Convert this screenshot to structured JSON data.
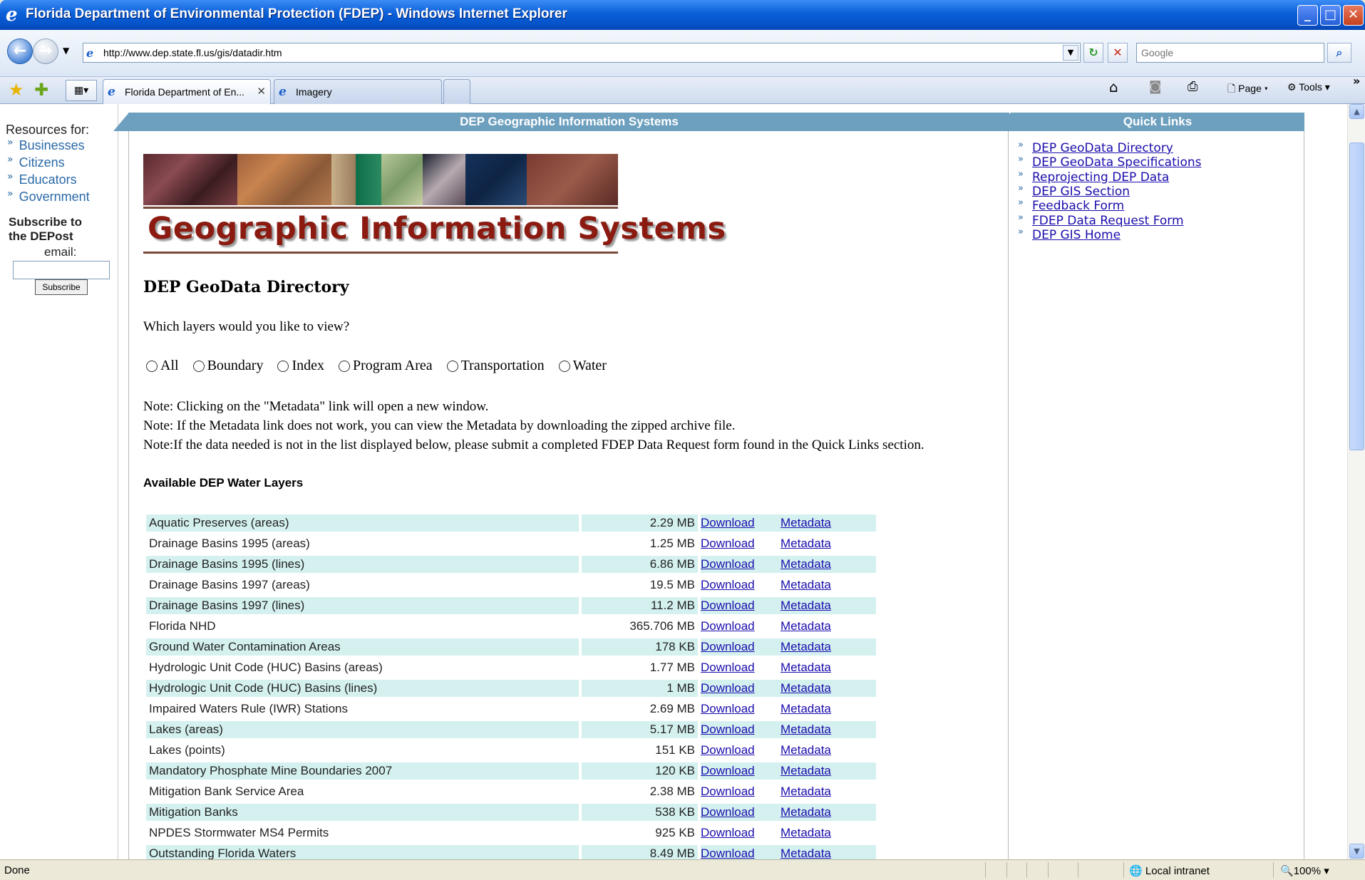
{
  "window": {
    "title": "Florida Department of Environmental Protection (FDEP) - Windows Internet Explorer"
  },
  "address_bar": {
    "url": "http://www.dep.state.fl.us/gis/datadir.htm",
    "search_placeholder": "Google"
  },
  "tabs": [
    {
      "label": "Florida Department of En...",
      "active": true
    },
    {
      "label": "Imagery",
      "active": false
    }
  ],
  "command_bar": {
    "page_label": "Page",
    "tools_label": "Tools"
  },
  "sidebar": {
    "resources_label": "Resources for:",
    "links": [
      "Businesses",
      "Citizens",
      "Educators",
      "Government"
    ],
    "subscribe_title": "Subscribe to the DEPost",
    "email_label": "email:",
    "subscribe_button": "Subscribe"
  },
  "main": {
    "banner": "DEP Geographic Information Systems",
    "logo_text": "Geographic Information Systems",
    "directory_title": "DEP GeoData Directory",
    "question": "Which layers would you like to view?",
    "layer_filters": [
      "All",
      "Boundary",
      "Index",
      "Program Area",
      "Transportation",
      "Water"
    ],
    "notes": [
      "Note: Clicking on the \"Metadata\" link will open a new window.",
      "Note: If the Metadata link does not work, you can view the Metadata by downloading the zipped archive file.",
      "Note:If the data needed is not in the list displayed below, please submit a completed FDEP Data Request form found in the Quick Links section."
    ],
    "available_title": "Available DEP Water Layers",
    "download_label": "Download",
    "metadata_label": "Metadata",
    "layers": [
      {
        "name": "Aquatic Preserves (areas)",
        "size": "2.29 MB"
      },
      {
        "name": "Drainage Basins 1995 (areas)",
        "size": "1.25 MB"
      },
      {
        "name": "Drainage Basins 1995 (lines)",
        "size": "6.86 MB"
      },
      {
        "name": "Drainage Basins 1997 (areas)",
        "size": "19.5 MB"
      },
      {
        "name": "Drainage Basins 1997 (lines)",
        "size": "11.2 MB"
      },
      {
        "name": "Florida NHD",
        "size": "365.706 MB"
      },
      {
        "name": "Ground Water Contamination Areas",
        "size": "178 KB"
      },
      {
        "name": "Hydrologic Unit Code (HUC) Basins (areas)",
        "size": "1.77 MB"
      },
      {
        "name": "Hydrologic Unit Code (HUC) Basins (lines)",
        "size": "1 MB"
      },
      {
        "name": "Impaired Waters Rule (IWR) Stations",
        "size": "2.69 MB"
      },
      {
        "name": "Lakes (areas)",
        "size": "5.17 MB"
      },
      {
        "name": "Lakes (points)",
        "size": "151 KB"
      },
      {
        "name": "Mandatory Phosphate Mine Boundaries 2007",
        "size": "120 KB"
      },
      {
        "name": "Mitigation Bank Service Area",
        "size": "2.38 MB"
      },
      {
        "name": "Mitigation Banks",
        "size": "538 KB"
      },
      {
        "name": "NPDES Stormwater MS4 Permits",
        "size": "925 KB"
      },
      {
        "name": "Outstanding Florida Waters",
        "size": "8.49 MB"
      }
    ]
  },
  "quick_links": {
    "title": "Quick Links",
    "links": [
      "DEP GeoData Directory",
      "DEP GeoData Specifications",
      "Reprojecting DEP Data",
      "DEP GIS Section",
      "Feedback Form",
      "FDEP Data Request Form",
      "DEP GIS Home"
    ]
  },
  "status_bar": {
    "status": "Done",
    "zone": "Local intranet",
    "zoom": "100%"
  },
  "colors": {
    "banner": "#6d9fbe",
    "row_shade": "#d4f1f0",
    "link": "#1a0dab",
    "logo_text": "#8b1a10"
  }
}
